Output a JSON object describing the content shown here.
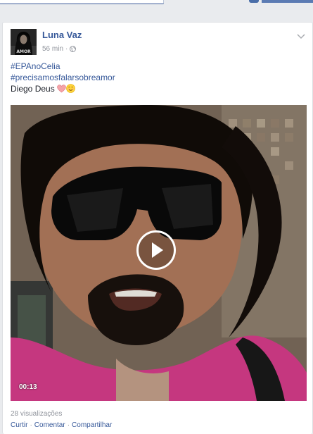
{
  "post": {
    "author": "Luna Vaz",
    "time": "56 min",
    "separator": "·",
    "lines": [
      "#EPAnoCelia",
      "#precisamosfalarsobreamor",
      "Diego Deus"
    ],
    "emojis": [
      "heart",
      "smiling-face"
    ]
  },
  "video": {
    "duration": "00:13"
  },
  "stats": {
    "views": "28 visualizações"
  },
  "actions": {
    "like": "Curtir",
    "comment": "Comentar",
    "share": "Compartilhar",
    "separator": "·"
  },
  "colors": {
    "link": "#365899",
    "meta": "#90949c",
    "background": "#e9ebee",
    "card": "#ffffff"
  },
  "icons": [
    "globe-icon",
    "chevron-down-icon",
    "play-icon",
    "heart-emoji",
    "smiling-face-emoji"
  ]
}
